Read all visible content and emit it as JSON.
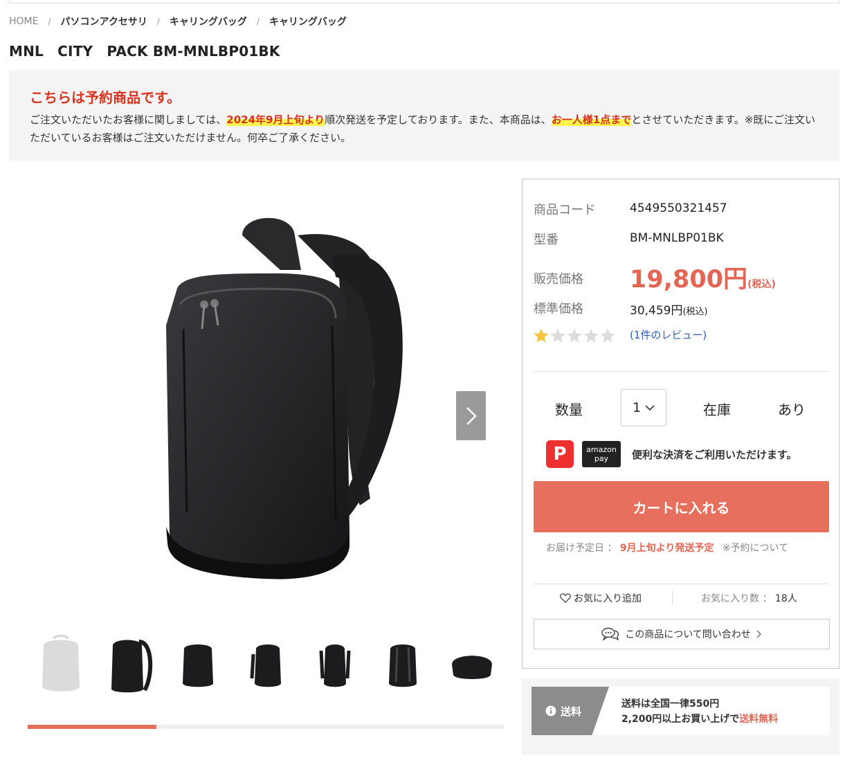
{
  "breadcrumb": {
    "home": "HOME",
    "items": [
      "パソコンアクセサリ",
      "キャリングバッグ",
      "キャリングバッグ"
    ],
    "sep": "/"
  },
  "product_title": "MNL　CITY　PACK BM-MNLBP01BK",
  "notice": {
    "title": "こちらは予約商品です。",
    "text_1": "ご注文いただいたお客様に関しましては、",
    "highlight_1": "2024年9月上旬より",
    "text_2": "順次発送を予定しております。また、本商品は、",
    "highlight_2": "お一人様1点まで",
    "text_3": "とさせていただきます。※既にご注文いただいているお客様はご注文いただけません。何卒ご了承ください。"
  },
  "gallery": {
    "next_icon": "chevron-right-icon",
    "thumb_count": 7,
    "progress_fraction": 0.27
  },
  "info": {
    "code_label": "商品コード",
    "code_value": "4549550321457",
    "model_label": "型番",
    "model_value": "BM-MNLBP01BK",
    "price_label": "販売価格",
    "price_value": "19,800円",
    "price_tax": "(税込)",
    "std_label": "標準価格",
    "std_value": "30,459円",
    "std_tax": "(税込)",
    "rating": 1,
    "rating_max": 5,
    "reviews": "(1件のレビュー)"
  },
  "purchase": {
    "qty_label": "数量",
    "qty_value": "1",
    "stock_label": "在庫",
    "stock_value": "あり",
    "amazon_line1": "amazon",
    "amazon_line2": "pay",
    "payment_text": "便利な決済をご利用いただけます。",
    "cart_button": "カートに入れる",
    "delivery_label": "お届け予定日 ：",
    "delivery_value": "9月上旬より発送予定",
    "delivery_note": "※予約について",
    "fav_add": "お気に入り追加",
    "fav_count_label": "お気に入り数 ：",
    "fav_count": "18人",
    "inquiry": "この商品について問い合わせ"
  },
  "shipping": {
    "tag": "送料",
    "line1": "送料は全国一律550円",
    "line2_a": "2,200円以上お買い上げで",
    "line2_b": "送料無料"
  },
  "colors": {
    "accent": "#e66f5d",
    "alert": "#d7331c",
    "link": "#2b5db3",
    "star": "#f4c542"
  }
}
